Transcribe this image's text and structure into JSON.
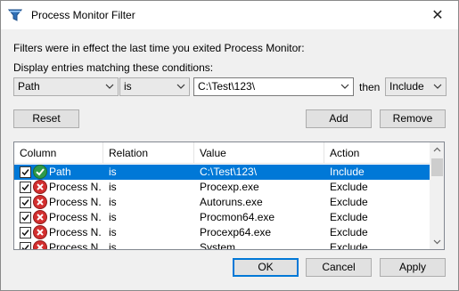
{
  "window": {
    "title": "Process Monitor Filter",
    "close_glyph": "✕"
  },
  "intro_text": "Filters were in effect the last time you exited Process Monitor:",
  "conditions_label": "Display entries matching these conditions:",
  "condition": {
    "column": "Path",
    "relation": "is",
    "value": "C:\\Test\\123\\",
    "then_label": "then",
    "action": "Include"
  },
  "buttons": {
    "reset": "Reset",
    "add": "Add",
    "remove": "Remove",
    "ok": "OK",
    "cancel": "Cancel",
    "apply": "Apply"
  },
  "list": {
    "headers": [
      "Column",
      "Relation",
      "Value",
      "Action"
    ],
    "rows": [
      {
        "column": "Path",
        "relation": "is",
        "value": "C:\\Test\\123\\",
        "action": "Include",
        "icon": "include-icon",
        "selected": true
      },
      {
        "column": "Process N...",
        "relation": "is",
        "value": "Procexp.exe",
        "action": "Exclude",
        "icon": "exclude-icon",
        "selected": false
      },
      {
        "column": "Process N...",
        "relation": "is",
        "value": "Autoruns.exe",
        "action": "Exclude",
        "icon": "exclude-icon",
        "selected": false
      },
      {
        "column": "Process N...",
        "relation": "is",
        "value": "Procmon64.exe",
        "action": "Exclude",
        "icon": "exclude-icon",
        "selected": false
      },
      {
        "column": "Process N...",
        "relation": "is",
        "value": "Procexp64.exe",
        "action": "Exclude",
        "icon": "exclude-icon",
        "selected": false
      },
      {
        "column": "Process N...",
        "relation": "is",
        "value": "System",
        "action": "Exclude",
        "icon": "exclude-icon",
        "selected": false
      }
    ]
  },
  "colors": {
    "selection": "#0078d7",
    "include_icon": "#2e9a4a",
    "exclude_icon": "#d32f2f"
  }
}
